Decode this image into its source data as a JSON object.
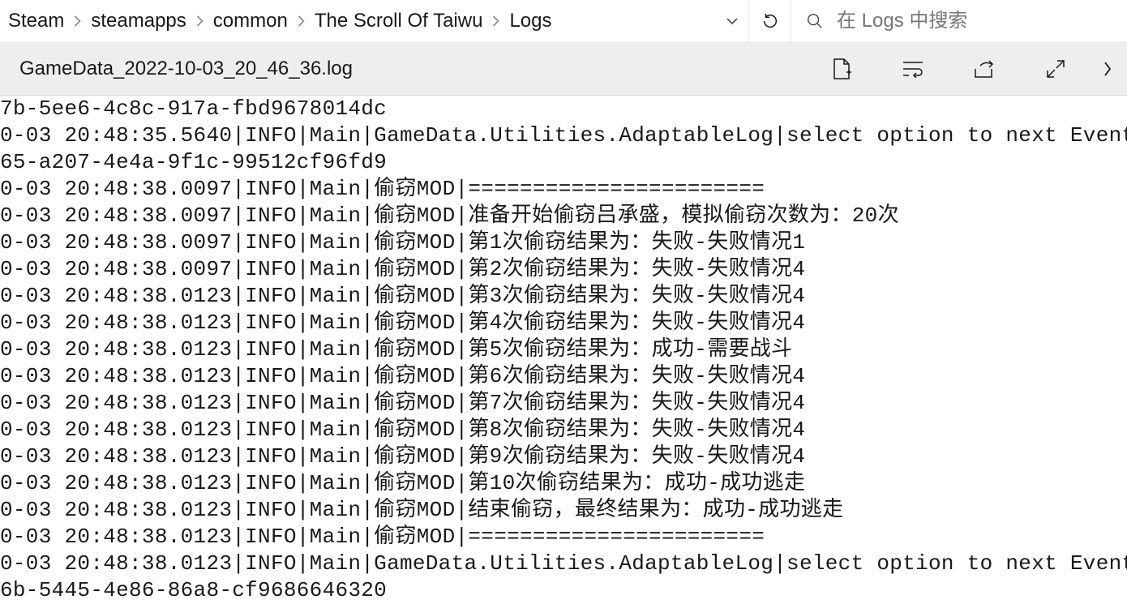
{
  "breadcrumb": {
    "items": [
      "Steam",
      "steamapps",
      "common",
      "The Scroll Of Taiwu",
      "Logs"
    ]
  },
  "search": {
    "placeholder": "在 Logs 中搜索"
  },
  "tab": {
    "filename": "GameData_2022-10-03_20_46_36.log"
  },
  "log": {
    "lines": [
      "7b-5ee6-4c8c-917a-fbd9678014dc",
      "0-03 20:48:35.5640|INFO|Main|GameData.Utilities.AdaptableLog|select option to next Event:",
      "65-a207-4e4a-9f1c-99512cf96fd9",
      "0-03 20:48:38.0097|INFO|Main|偷窃MOD|=======================",
      "0-03 20:48:38.0097|INFO|Main|偷窃MOD|准备开始偷窃吕承盛，模拟偷窃次数为：20次",
      "0-03 20:48:38.0097|INFO|Main|偷窃MOD|第1次偷窃结果为：失败-失败情况1",
      "0-03 20:48:38.0097|INFO|Main|偷窃MOD|第2次偷窃结果为：失败-失败情况4",
      "0-03 20:48:38.0123|INFO|Main|偷窃MOD|第3次偷窃结果为：失败-失败情况4",
      "0-03 20:48:38.0123|INFO|Main|偷窃MOD|第4次偷窃结果为：失败-失败情况4",
      "0-03 20:48:38.0123|INFO|Main|偷窃MOD|第5次偷窃结果为：成功-需要战斗",
      "0-03 20:48:38.0123|INFO|Main|偷窃MOD|第6次偷窃结果为：失败-失败情况4",
      "0-03 20:48:38.0123|INFO|Main|偷窃MOD|第7次偷窃结果为：失败-失败情况4",
      "0-03 20:48:38.0123|INFO|Main|偷窃MOD|第8次偷窃结果为：失败-失败情况4",
      "0-03 20:48:38.0123|INFO|Main|偷窃MOD|第9次偷窃结果为：失败-失败情况4",
      "0-03 20:48:38.0123|INFO|Main|偷窃MOD|第10次偷窃结果为：成功-成功逃走",
      "0-03 20:48:38.0123|INFO|Main|偷窃MOD|结束偷窃，最终结果为：成功-成功逃走",
      "0-03 20:48:38.0123|INFO|Main|偷窃MOD|=======================",
      "0-03 20:48:38.0123|INFO|Main|GameData.Utilities.AdaptableLog|select option to next Event:",
      "6b-5445-4e86-86a8-cf9686646320"
    ]
  }
}
